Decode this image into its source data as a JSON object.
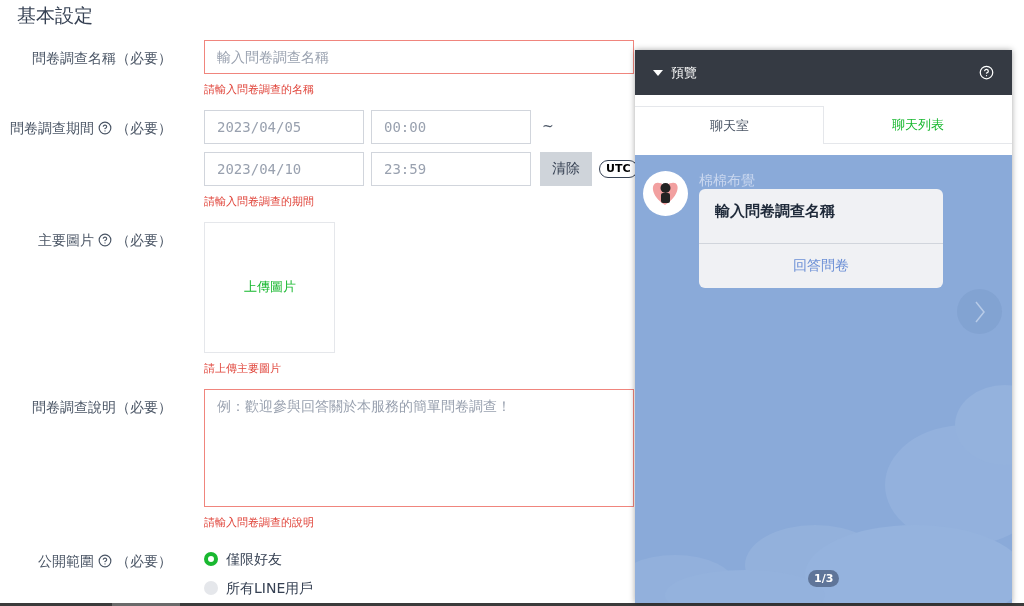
{
  "heading": "基本設定",
  "fields": [
    {
      "kind": "text",
      "label": "問卷調查名稱",
      "help": false,
      "required": "（必要）",
      "placeholder": "輸入問卷調查名稱",
      "error": "請輸入問卷調查的名稱"
    },
    {
      "kind": "period",
      "label": "問卷調查期間",
      "help": true,
      "required": "（必要）",
      "start_date": "2023/04/05",
      "start_time": "00:00",
      "separator": "~",
      "end_date": "2023/04/10",
      "end_time": "23:59",
      "clear": "清除",
      "timezone": "UTC",
      "error": "請輸入問卷調查的期間"
    },
    {
      "label": "主要圖片",
      "help": true,
      "required": "（必要）",
      "upload": "上傳圖片",
      "error": "請上傳主要圖片"
    },
    {
      "kind": "textarea",
      "label": "問卷調查說明",
      "help": false,
      "required": "（必要）",
      "placeholder": "例：歡迎參與回答關於本服務的簡單問卷調查！",
      "error": "請輸入問卷調查的說明"
    },
    {
      "kind": "radio",
      "label": "公開範圍",
      "help": true,
      "required": "（必要）",
      "options": [
        {
          "label": "僅限好友",
          "selected": true
        },
        {
          "label": "所有LINE用戶",
          "selected": false
        }
      ]
    }
  ],
  "preview": {
    "title": "預覽",
    "tabs": [
      {
        "label": "聊天室",
        "selected": true
      },
      {
        "label": "聊天列表",
        "selected": false
      }
    ],
    "sender": "棉棉布覺",
    "card_title": "輸入問卷調查名稱",
    "card_action": "回答問卷",
    "pager": "1/3"
  }
}
